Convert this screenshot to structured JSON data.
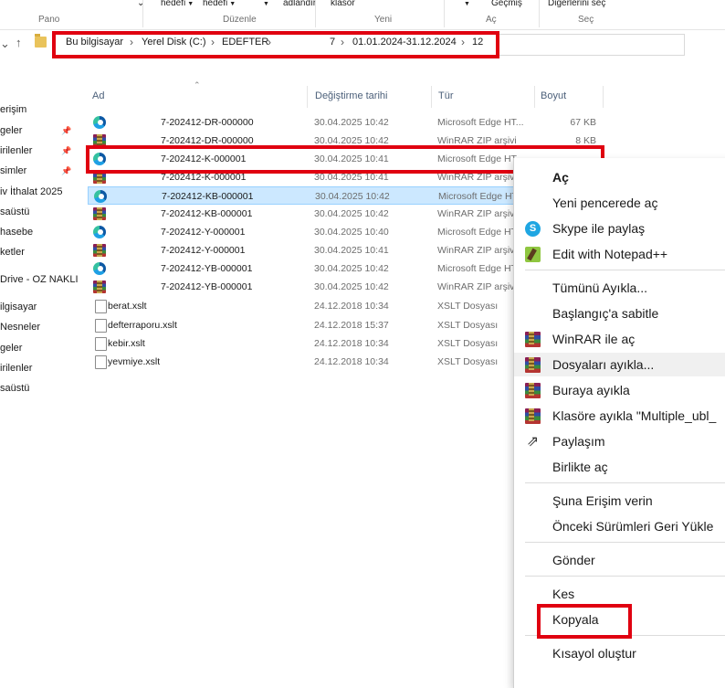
{
  "ribbon": {
    "fragments": [
      "hedefi",
      "hedefi",
      "adlandır",
      "klasör",
      "Geçmiş",
      "Diğerlerini seç"
    ],
    "groups": [
      "Pano",
      "Düzenle",
      "Yeni",
      "Aç",
      "Seç"
    ]
  },
  "breadcrumb": [
    "Bu bilgisayar",
    "Yerel Disk (C:)",
    "EDEFTER",
    "7",
    "01.01.2024-31.12.2024",
    "12"
  ],
  "sidebar": [
    "erişim",
    "geler",
    "irilenler",
    "simler",
    "iv İthalat 2025",
    "saüstü",
    "hasebe",
    "ketler",
    "Drive - OZ NAKLI",
    "ilgisayar",
    "Nesneler",
    "geler",
    "irilenler",
    "saüstü"
  ],
  "columns": {
    "name": "Ad",
    "date": "Değiştirme tarihi",
    "type": "Tür",
    "size": "Boyut"
  },
  "files": [
    {
      "name": "7-202412-DR-000000",
      "date": "30.04.2025 10:42",
      "type": "Microsoft Edge HT...",
      "size": "67 KB",
      "icon": "edge-icon"
    },
    {
      "name": "7-202412-DR-000000",
      "date": "30.04.2025 10:42",
      "type": "WinRAR ZIP arşivi",
      "size": "8 KB",
      "icon": "winrar-icon"
    },
    {
      "name": "7-202412-K-000001",
      "date": "30.04.2025 10:41",
      "type": "Microsoft Edge HT...",
      "size": "",
      "icon": "edge-icon"
    },
    {
      "name": "7-202412-K-000001",
      "date": "30.04.2025 10:41",
      "type": "WinRAR ZIP arşivi",
      "size": "",
      "icon": "winrar-icon"
    },
    {
      "name": "7-202412-KB-000001",
      "date": "30.04.2025 10:42",
      "type": "Microsoft Edge HT...",
      "size": "",
      "icon": "edge-icon"
    },
    {
      "name": "7-202412-KB-000001",
      "date": "30.04.2025 10:42",
      "type": "WinRAR ZIP arşivi",
      "size": "",
      "icon": "winrar-icon"
    },
    {
      "name": "7-202412-Y-000001",
      "date": "30.04.2025 10:40",
      "type": "Microsoft Edge HT...",
      "size": "",
      "icon": "edge-icon"
    },
    {
      "name": "7-202412-Y-000001",
      "date": "30.04.2025 10:41",
      "type": "WinRAR ZIP arşivi",
      "size": "",
      "icon": "winrar-icon"
    },
    {
      "name": "7-202412-YB-000001",
      "date": "30.04.2025 10:42",
      "type": "Microsoft Edge HT...",
      "size": "",
      "icon": "edge-icon"
    },
    {
      "name": "7-202412-YB-000001",
      "date": "30.04.2025 10:42",
      "type": "WinRAR ZIP arşivi",
      "size": "",
      "icon": "winrar-icon"
    },
    {
      "name": "berat.xslt",
      "date": "24.12.2018 10:34",
      "type": "XSLT Dosyası",
      "size": "",
      "icon": "document-icon"
    },
    {
      "name": "defterraporu.xslt",
      "date": "24.12.2018 15:37",
      "type": "XSLT Dosyası",
      "size": "",
      "icon": "document-icon"
    },
    {
      "name": "kebir.xslt",
      "date": "24.12.2018 10:34",
      "type": "XSLT Dosyası",
      "size": "",
      "icon": "document-icon"
    },
    {
      "name": "yevmiye.xslt",
      "date": "24.12.2018 10:34",
      "type": "XSLT Dosyası",
      "size": "",
      "icon": "document-icon"
    }
  ],
  "context_menu": [
    {
      "label": "Aç",
      "bold": true,
      "icon": ""
    },
    {
      "label": "Yeni pencerede aç",
      "icon": ""
    },
    {
      "label": "Skype ile paylaş",
      "icon": "skype-icon"
    },
    {
      "label": "Edit with Notepad++",
      "icon": "notepadpp-icon"
    },
    {
      "label": "Tümünü Ayıkla...",
      "icon": ""
    },
    {
      "label": "Başlangıç'a sabitle",
      "icon": ""
    },
    {
      "label": "WinRAR ile aç",
      "icon": "winrar-icon"
    },
    {
      "label": "Dosyaları ayıkla...",
      "icon": "winrar-icon"
    },
    {
      "label": "Buraya ayıkla",
      "icon": "winrar-icon"
    },
    {
      "label": "Klasöre ayıkla \"Multiple_ubl_",
      "icon": "winrar-icon"
    },
    {
      "label": "Paylaşım",
      "icon": "share-icon"
    },
    {
      "label": "Birlikte aç",
      "icon": ""
    },
    {
      "label": "Şuna Erişim verin",
      "icon": ""
    },
    {
      "label": "Önceki Sürümleri Geri Yükle",
      "icon": ""
    },
    {
      "label": "Gönder",
      "icon": ""
    },
    {
      "label": "Kes",
      "icon": ""
    },
    {
      "label": "Kopyala",
      "icon": ""
    },
    {
      "label": "Kısayol oluştur",
      "icon": ""
    }
  ],
  "colors": {
    "highlight_red": "#e00010",
    "selection": "#cce8ff"
  }
}
